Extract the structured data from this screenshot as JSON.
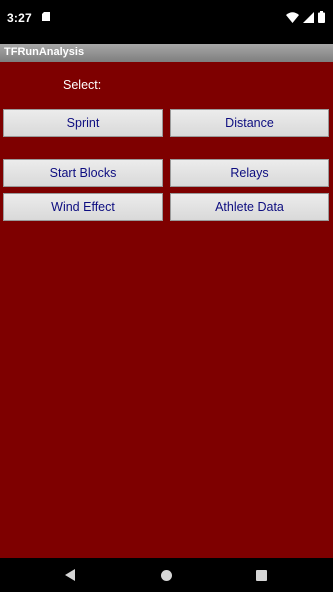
{
  "status_bar": {
    "time": "3:27",
    "icons": [
      "sd-card-icon",
      "wifi-icon",
      "cellular-signal-icon",
      "battery-icon"
    ]
  },
  "app": {
    "title": "TFRunAnalysis"
  },
  "main": {
    "select_label": "Select:",
    "buttons": {
      "sprint": "Sprint",
      "distance": "Distance",
      "start_blocks": "Start Blocks",
      "relays": "Relays",
      "wind_effect": "Wind Effect",
      "athlete_data": "Athlete Data"
    }
  },
  "nav_bar": {
    "icons": [
      "back-icon",
      "home-icon",
      "recents-icon"
    ]
  },
  "colors": {
    "background": "#7e0000",
    "button_text": "#0d0d80",
    "title_bar": "#8f8f8f"
  }
}
